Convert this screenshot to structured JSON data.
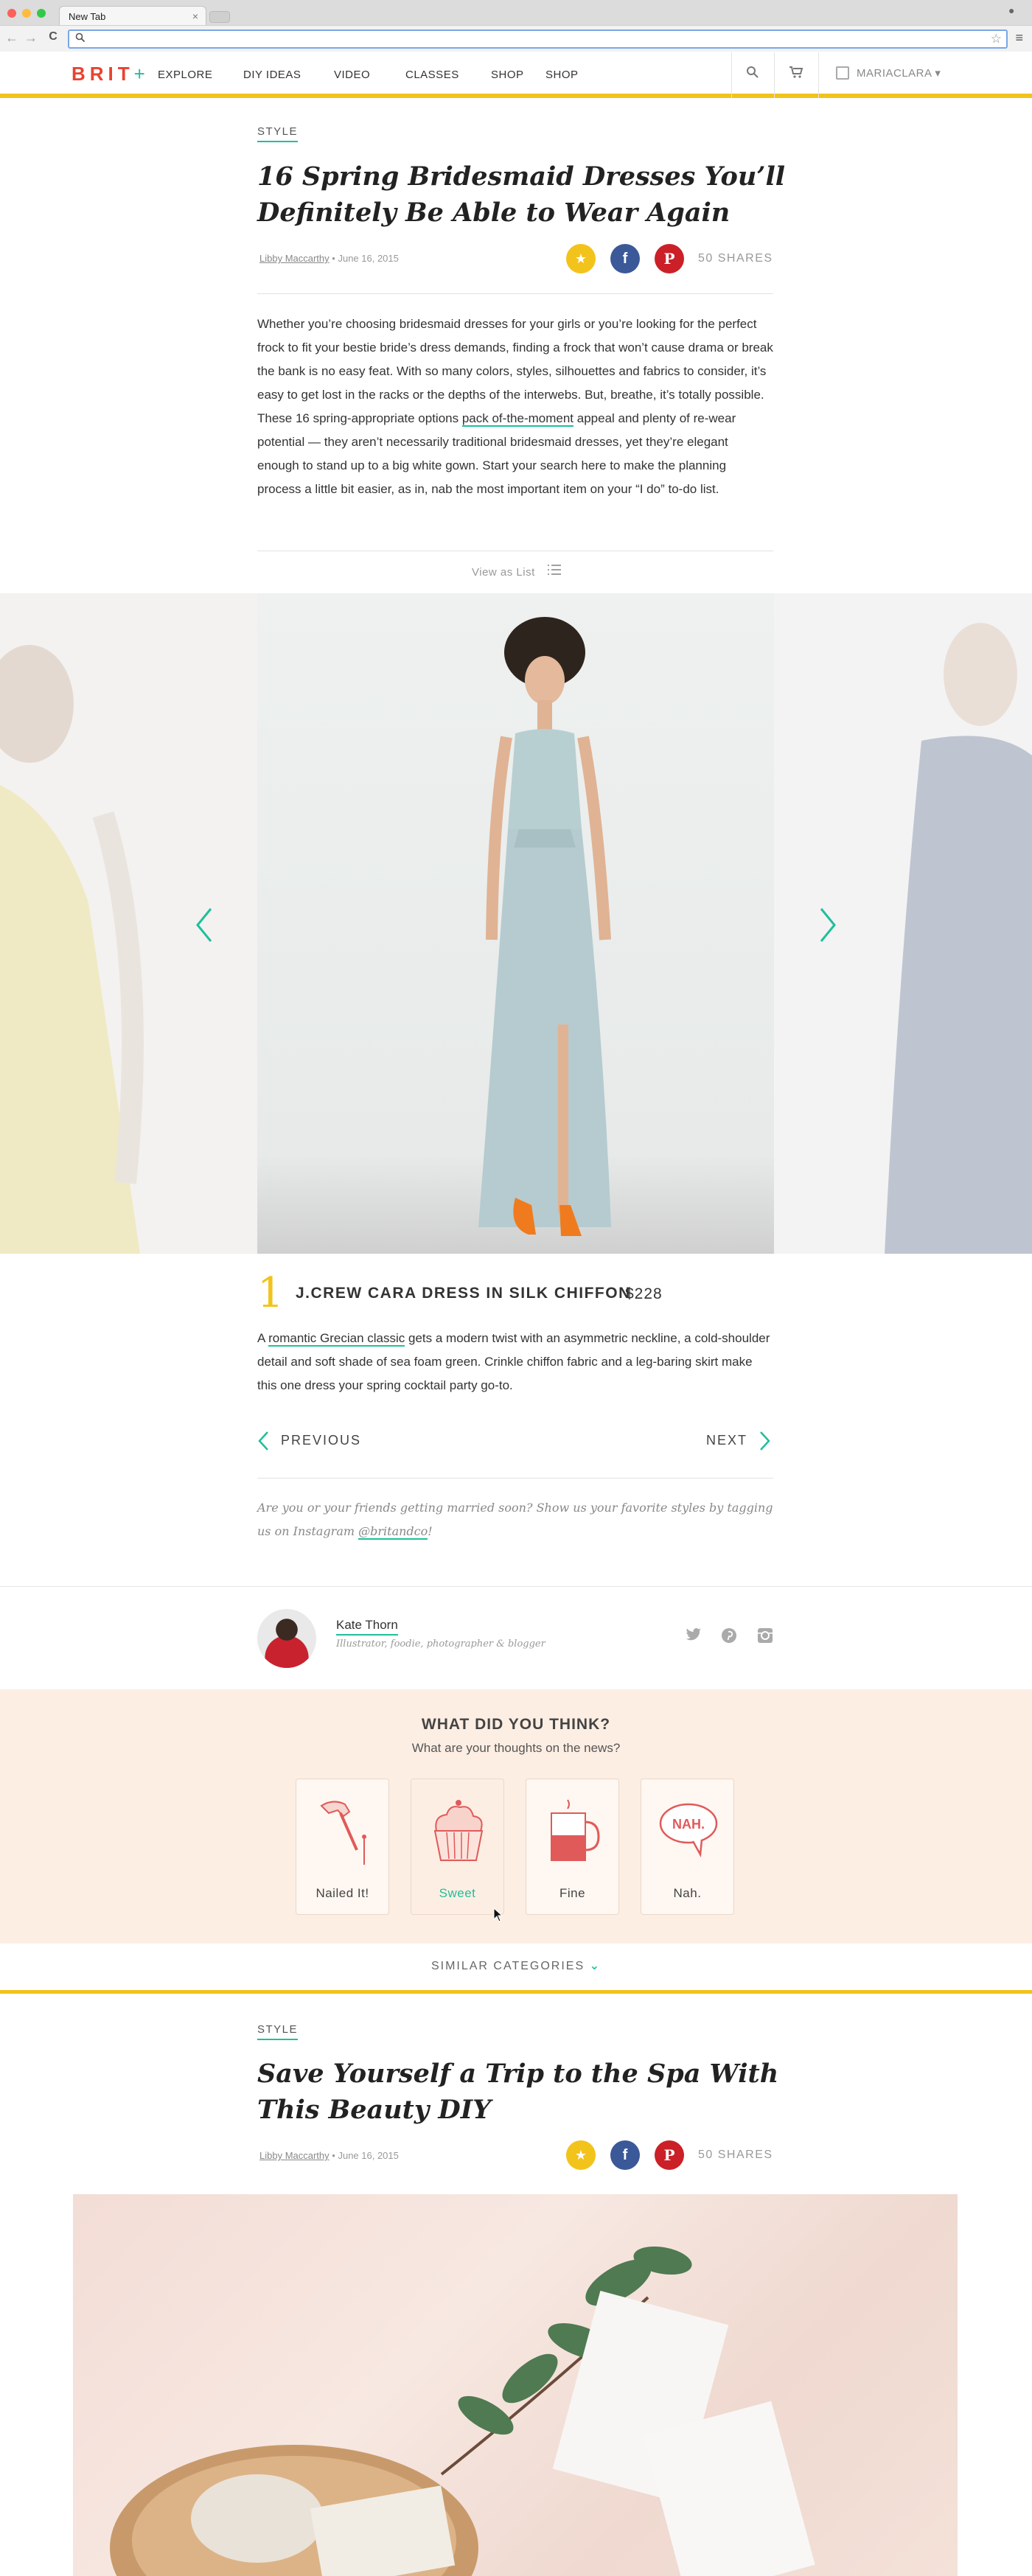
{
  "browser": {
    "tab_title": "New Tab",
    "tab_close": "×",
    "url_value": "",
    "nav_back": "←",
    "nav_forward": "→",
    "nav_reload": "C",
    "star": "☆",
    "menu": "≡",
    "profile": "●"
  },
  "site": {
    "logo_text": "BRIT",
    "logo_plus": "+",
    "nav": [
      "EXPLORE",
      "DIY IDEAS",
      "VIDEO",
      "CLASSES",
      "SHOP",
      "SHOP"
    ],
    "search_icon": "⌕",
    "cart_icon": "🛒",
    "username": "MARIACLARA",
    "username_caret": "▾",
    "colors": {
      "accent": "#1fbf9b",
      "brand_red": "#e8432f",
      "yellow": "#f2c31b",
      "facebook": "#3b5998",
      "pinterest": "#cb2027"
    }
  },
  "article": {
    "category": "STYLE",
    "title": "16 Spring Bridesmaid Dresses You’ll Definitely Be Able to Wear Again",
    "author": "Libby Maccarthy",
    "date_sep": "•",
    "date": "June 16, 2015",
    "share_star": "★",
    "share_fb": "f",
    "share_pin": "P",
    "shares": "50 SHARES",
    "body_part1": "Whether you’re choosing bridesmaid dresses for your girls or you’re looking for the perfect frock to fit your bestie bride’s dress demands, finding a frock that won’t cause drama or break the bank is no easy feat. With so many colors, styles, silhouettes and fabrics to consider, it’s easy to get lost in the racks or the depths of the interwebs. But, breathe, it’s totally possible. These 16 spring-appropriate options ",
    "body_link": "pack of-the-moment",
    "body_part2": " appeal and plenty of re-wear potential — they aren’t necessarily traditional bridesmaid dresses, yet they’re elegant enough to stand up to a big white gown. Start your search here to make the planning process a little bit easier, as in, nab the most important item on your “I do” to-do list.",
    "view_as_list": "View as List"
  },
  "slide": {
    "number": "1",
    "product": "J.CREW CARA DRESS IN SILK CHIFFON",
    "price": "$228",
    "desc_pre": "A ",
    "desc_link": "romantic Grecian classic",
    "desc_post": " gets a modern twist with an asymmetric neckline, a cold-shoulder detail and soft shade of sea foam green. Crinkle chiffon fabric and a leg-baring skirt make this one dress your spring cocktail party go-to.",
    "previous": "PREVIOUS",
    "next": "NEXT",
    "prev_arrow": "‹",
    "next_arrow": "›"
  },
  "note": {
    "text": "Are you or your friends getting married soon? Show us your favorite styles by tagging us on Instagram ",
    "handle": "@britandco",
    "end": "!"
  },
  "author": {
    "name": "Kate Thorn",
    "bio": "Illustrator, foodie, photographer & blogger",
    "twitter": "🐦",
    "pinterest": "℗",
    "instagram": "▣"
  },
  "feedback": {
    "title": "WHAT DID YOU THINK?",
    "subtitle": "What are your thoughts on the news?",
    "options": [
      {
        "label": "Nailed It!",
        "icon": "hammer-icon"
      },
      {
        "label": "Sweet",
        "icon": "cupcake-icon"
      },
      {
        "label": "Fine",
        "icon": "mug-icon"
      },
      {
        "label": "Nah.",
        "icon": "speech-bubble-icon"
      }
    ],
    "bubble_text": "NAH."
  },
  "similar": {
    "label": "SIMILAR CATEGORIES",
    "caret": "⌄"
  },
  "article2": {
    "category": "STYLE",
    "title": "Save Yourself a Trip to the Spa With This Beauty DIY",
    "author": "Libby Maccarthy",
    "date_sep": "•",
    "date": "June 16, 2015",
    "shares": "50 SHARES"
  }
}
